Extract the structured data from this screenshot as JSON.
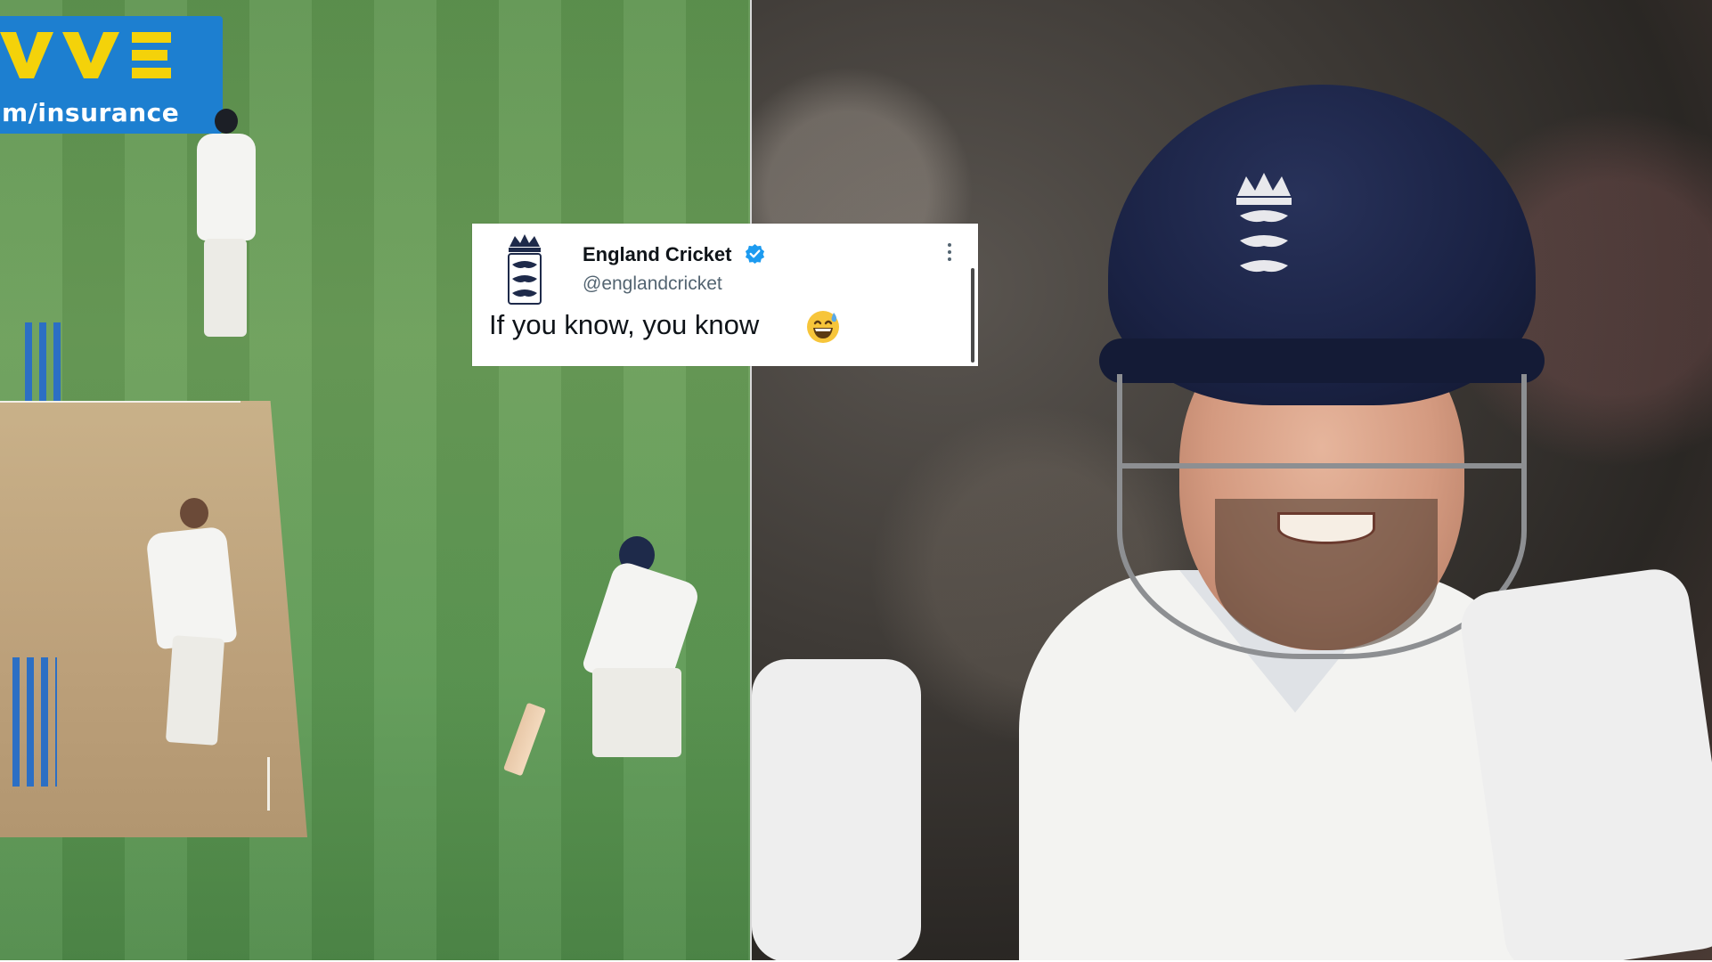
{
  "image": {
    "left_panel": {
      "ad_board": {
        "text": "m/insurance",
        "color": "#1d7fd0"
      }
    },
    "right_panel": {
      "helmet_color": "#1a2244"
    }
  },
  "tweet": {
    "account_name": "England Cricket",
    "handle": "@englandcricket",
    "verified": true,
    "text": "If you know, you know",
    "emoji": "grinning-face-with-sweat",
    "colors": {
      "verified": "#1d9bf0",
      "name": "#0f1419",
      "handle": "#536471"
    }
  }
}
